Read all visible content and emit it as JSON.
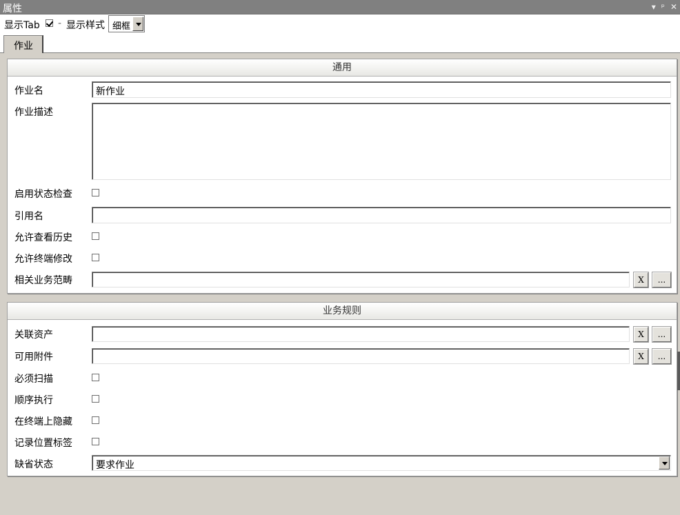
{
  "window": {
    "title": "属性",
    "pin_symbol": "▾",
    "pin_glyph": "ᵖ",
    "close_symbol": "✕"
  },
  "toolbar": {
    "show_tab_label": "显示Tab",
    "show_tab_checked": true,
    "separator": "-",
    "display_style_label": "显示样式",
    "display_style_value": "细框"
  },
  "tabs": [
    {
      "label": "作业",
      "active": true
    }
  ],
  "general": {
    "header": "通用",
    "job_name_label": "作业名",
    "job_name_value": "新作业",
    "job_desc_label": "作业描述",
    "job_desc_value": "",
    "enable_status_check_label": "启用状态检查",
    "ref_name_label": "引用名",
    "ref_name_value": "",
    "allow_history_label": "允许查看历史",
    "allow_terminal_edit_label": "允许终端修改",
    "business_scope_label": "相关业务范畴",
    "business_scope_value": ""
  },
  "rules": {
    "header": "业务规则",
    "assets_label": "关联资产",
    "assets_value": "",
    "attachments_label": "可用附件",
    "attachments_value": "",
    "must_scan_label": "必须扫描",
    "sequential_label": "顺序执行",
    "hide_on_terminal_label": "在终端上隐藏",
    "record_location_label": "记录位置标签",
    "default_status_label": "缺省状态",
    "default_status_value": "要求作业"
  },
  "buttons": {
    "clear_label": "X",
    "browse_label": "..."
  }
}
